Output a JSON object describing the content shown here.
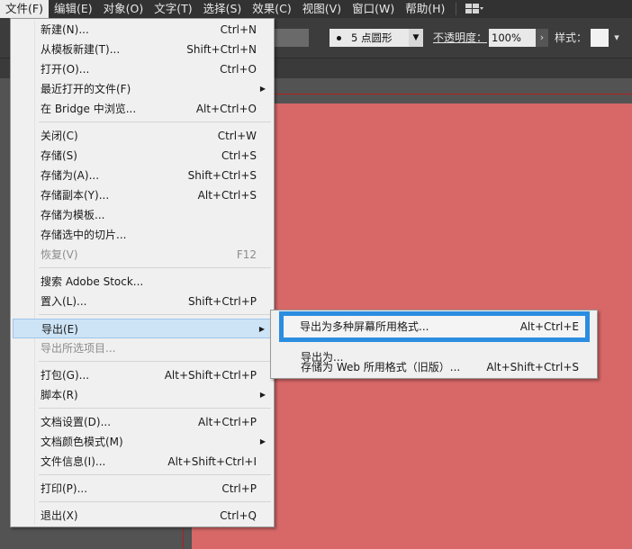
{
  "menubar": {
    "items": [
      "文件(F)",
      "编辑(E)",
      "对象(O)",
      "文字(T)",
      "选择(S)",
      "效果(C)",
      "视图(V)",
      "窗口(W)",
      "帮助(H)"
    ],
    "active_index": 0,
    "layout_icon": "workspace-grid-icon"
  },
  "controlbar": {
    "brush": {
      "size": "5",
      "shape": "点圆形"
    },
    "opacity_label": "不透明度：",
    "opacity_value": "100%",
    "style_label": "样式："
  },
  "colors": {
    "artboard": "#d86868",
    "highlight_ring": "#2b8de0",
    "menu_bg": "#f0f0f0"
  },
  "file_menu": {
    "items": [
      {
        "label": "新建(N)...",
        "shortcut": "Ctrl+N"
      },
      {
        "label": "从模板新建(T)...",
        "shortcut": "Shift+Ctrl+N"
      },
      {
        "label": "打开(O)...",
        "shortcut": "Ctrl+O"
      },
      {
        "label": "最近打开的文件(F)",
        "shortcut": "",
        "submenu": true
      },
      {
        "label": "在 Bridge 中浏览...",
        "shortcut": "Alt+Ctrl+O"
      },
      {
        "label": "关闭(C)",
        "shortcut": "Ctrl+W"
      },
      {
        "label": "存储(S)",
        "shortcut": "Ctrl+S"
      },
      {
        "label": "存储为(A)...",
        "shortcut": "Shift+Ctrl+S"
      },
      {
        "label": "存储副本(Y)...",
        "shortcut": "Alt+Ctrl+S"
      },
      {
        "label": "存储为模板...",
        "shortcut": ""
      },
      {
        "label": "存储选中的切片...",
        "shortcut": ""
      },
      {
        "label": "恢复(V)",
        "shortcut": "F12",
        "disabled": true
      },
      {
        "label": "搜索 Adobe Stock...",
        "shortcut": ""
      },
      {
        "label": "置入(L)...",
        "shortcut": "Shift+Ctrl+P"
      },
      {
        "label": "导出(E)",
        "shortcut": "",
        "submenu": true,
        "highlighted": true
      },
      {
        "label": "导出所选项目...",
        "shortcut": "",
        "disabled": true
      },
      {
        "label": "打包(G)...",
        "shortcut": "Alt+Shift+Ctrl+P"
      },
      {
        "label": "脚本(R)",
        "shortcut": "",
        "submenu": true
      },
      {
        "label": "文档设置(D)...",
        "shortcut": "Alt+Ctrl+P"
      },
      {
        "label": "文档颜色模式(M)",
        "shortcut": "",
        "submenu": true
      },
      {
        "label": "文件信息(I)...",
        "shortcut": "Alt+Shift+Ctrl+I"
      },
      {
        "label": "打印(P)...",
        "shortcut": "Ctrl+P"
      },
      {
        "label": "退出(X)",
        "shortcut": "Ctrl+Q"
      }
    ]
  },
  "export_submenu": {
    "items": [
      {
        "label": "导出为多种屏幕所用格式...",
        "shortcut": "Alt+Ctrl+E",
        "focused": true
      },
      {
        "label": "导出为...",
        "shortcut": ""
      },
      {
        "label": "存储为 Web 所用格式（旧版）...",
        "shortcut": "Alt+Shift+Ctrl+S"
      }
    ]
  }
}
